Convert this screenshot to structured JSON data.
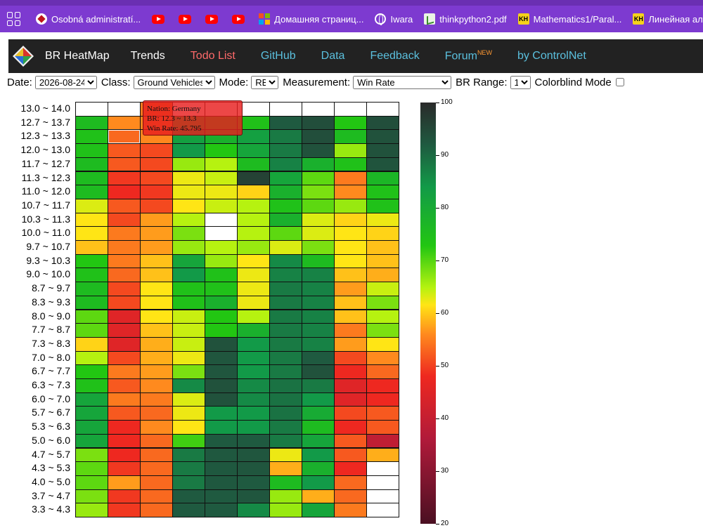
{
  "browser": {
    "bookmarks": [
      {
        "label": "Osobná administratí...",
        "icon": "red-diamond-icon"
      },
      {
        "label": "",
        "icon": "youtube-icon"
      },
      {
        "label": "",
        "icon": "youtube-icon"
      },
      {
        "label": "",
        "icon": "youtube-icon"
      },
      {
        "label": "",
        "icon": "youtube-icon"
      },
      {
        "label": "Домашняя страниц...",
        "icon": "microsoft-icon"
      },
      {
        "label": "Iwara",
        "icon": "globe-icon"
      },
      {
        "label": "thinkpython2.pdf",
        "icon": "book-icon"
      },
      {
        "label": "Mathematics1/Paral...",
        "icon": "kh-icon"
      },
      {
        "label": "Линейная алгебра...",
        "icon": "kh-icon"
      },
      {
        "label": "",
        "icon": "m-icon"
      }
    ]
  },
  "nav": {
    "brand": "BR HeatMap",
    "items": [
      {
        "label": "Trends"
      },
      {
        "label": "Todo List"
      },
      {
        "label": "GitHub"
      },
      {
        "label": "Data"
      },
      {
        "label": "Feedback"
      },
      {
        "label": "Forum",
        "badge": "NEW"
      },
      {
        "label": "by ControlNet"
      }
    ]
  },
  "controls": {
    "date_label": "Date:",
    "date_value": "2026-08-24",
    "class_label": "Class:",
    "class_value": "Ground Vehicles",
    "mode_label": "Mode:",
    "mode_value": "RB",
    "measurement_label": "Measurement:",
    "measurement_value": "Win Rate",
    "range_label": "BR Range:",
    "range_value": "1",
    "colorblind_label": "Colorblind Mode",
    "colorblind_checked": false
  },
  "tooltip": {
    "nation": "Nation: Germany",
    "br": "BR: 12.3 ~ 13.3",
    "win_rate": "Win Rate: 45.795"
  },
  "colorbar": {
    "min": 20,
    "max": 100,
    "ticks": [
      "100",
      "90",
      "80",
      "70",
      "60",
      "50",
      "40",
      "30",
      "20"
    ]
  },
  "chart_data": {
    "type": "heatmap",
    "measurement": "Win Rate",
    "rows": [
      "13.0 ~ 14.0",
      "12.7 ~ 13.7",
      "12.3 ~ 13.3",
      "12.0 ~ 13.0",
      "11.7 ~ 12.7",
      "11.3 ~ 12.3",
      "11.0 ~ 12.0",
      "10.7 ~ 11.7",
      "10.3 ~ 11.3",
      "10.0 ~ 11.0",
      "9.7 ~ 10.7",
      "9.3 ~ 10.3",
      "9.0 ~ 10.0",
      "8.7 ~ 9.7",
      "8.3 ~ 9.3",
      "8.0 ~ 9.0",
      "7.7 ~ 8.7",
      "7.3 ~ 8.3",
      "7.0 ~ 8.0",
      "6.7 ~ 7.7",
      "6.3 ~ 7.3",
      "6.0 ~ 7.0",
      "5.7 ~ 6.7",
      "5.3 ~ 6.3",
      "5.0 ~ 6.0",
      "4.7 ~ 5.7",
      "4.3 ~ 5.3",
      "4.0 ~ 5.0",
      "3.7 ~ 4.7",
      "3.3 ~ 4.3"
    ],
    "columns": 10,
    "values": [
      [
        null,
        null,
        45,
        null,
        null,
        null,
        null,
        null,
        null,
        null
      ],
      [
        62,
        46,
        45.8,
        64,
        63,
        61,
        76,
        82,
        60,
        82
      ],
      [
        61,
        44,
        45.8,
        67,
        64,
        67,
        72,
        82,
        62,
        80
      ],
      [
        61,
        43,
        42,
        68,
        60,
        66,
        72,
        80,
        56,
        80
      ],
      [
        62,
        43,
        42,
        56,
        55,
        62,
        71,
        64,
        61,
        79
      ],
      [
        62,
        41,
        42,
        52,
        54,
        88,
        66,
        58,
        45,
        63
      ],
      [
        62,
        40,
        41,
        52,
        52,
        50,
        64,
        57,
        46,
        61
      ],
      [
        53,
        43,
        42,
        51,
        54,
        55,
        61,
        58,
        56,
        61
      ],
      [
        51,
        42,
        47,
        55,
        null,
        55,
        64,
        53,
        50,
        52
      ],
      [
        51,
        45,
        47,
        57,
        null,
        55,
        58,
        53,
        51,
        50
      ],
      [
        49,
        45,
        47,
        56,
        55,
        56,
        53,
        57,
        51,
        49
      ],
      [
        60,
        45,
        49,
        66,
        56,
        51,
        70,
        62,
        51,
        49
      ],
      [
        61,
        44,
        49,
        68,
        61,
        52,
        71,
        71,
        49,
        48
      ],
      [
        62,
        42,
        51,
        61,
        61,
        52,
        72,
        71,
        47,
        54
      ],
      [
        62,
        42,
        51,
        61,
        64,
        52,
        72,
        71,
        49,
        57
      ],
      [
        58,
        38,
        51,
        54,
        60,
        55,
        72,
        71,
        49,
        55
      ],
      [
        58,
        38,
        49,
        54,
        60,
        64,
        72,
        71,
        45,
        57
      ],
      [
        50,
        38,
        48,
        54,
        80,
        68,
        72,
        71,
        47,
        51
      ],
      [
        55,
        42,
        48,
        52,
        78,
        68,
        72,
        76,
        42,
        46
      ],
      [
        60,
        45,
        47,
        57,
        78,
        68,
        72,
        80,
        40,
        44
      ],
      [
        61,
        43,
        46,
        70,
        80,
        70,
        73,
        72,
        38,
        40
      ],
      [
        66,
        45,
        45,
        53,
        80,
        70,
        73,
        68,
        38,
        40
      ],
      [
        66,
        43,
        44,
        52,
        68,
        68,
        73,
        65,
        42,
        43
      ],
      [
        66,
        40,
        46,
        51,
        68,
        68,
        72,
        62,
        40,
        43
      ],
      [
        66,
        40,
        44,
        59,
        76,
        76,
        72,
        66,
        43,
        34
      ],
      [
        57,
        40,
        44,
        72,
        77,
        78,
        52,
        68,
        43,
        48
      ],
      [
        58,
        41,
        44,
        72,
        77,
        78,
        48,
        64,
        40,
        null
      ],
      [
        58,
        47,
        44,
        72,
        77,
        76,
        62,
        68,
        44,
        null
      ],
      [
        57,
        41,
        44,
        76,
        76,
        78,
        56,
        48,
        44,
        null
      ],
      [
        56,
        41,
        44,
        76,
        76,
        70,
        56,
        66,
        45,
        null
      ]
    ],
    "highlight": {
      "row": 2,
      "col": 1
    }
  }
}
